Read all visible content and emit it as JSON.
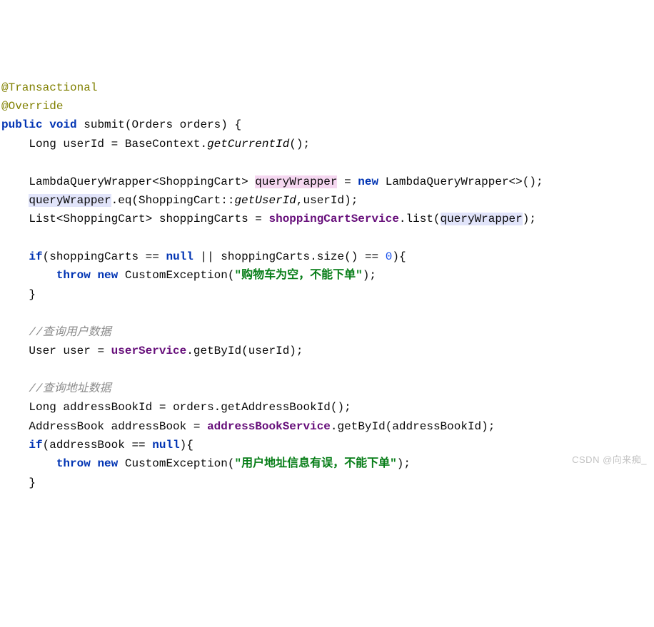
{
  "code": {
    "anno1": "@Transactional",
    "anno2": "@Override",
    "kw_public": "public",
    "kw_void": "void",
    "m_submit": "submit",
    "t_long": "Long",
    "v_userId": "userId",
    "t_basecontext": "BaseContext",
    "m_getCurrentId": "getCurrentId",
    "t_lqw": "LambdaQueryWrapper",
    "t_shoppingcart": "ShoppingCart",
    "v_querywrapper": "queryWrapper",
    "kw_new": "new",
    "m_eq": ".eq(",
    "m_getuserid": "getUserId",
    "t_list": "List",
    "v_shoppingcarts": "shoppingCarts",
    "f_shoppingcartservice": "shoppingCartService",
    "m_list": ".list(",
    "kw_if": "if",
    "kw_null": "null",
    "m_size": ".size()",
    "num_zero": "0",
    "kw_throw": "throw",
    "t_customexception": "CustomException",
    "str_carterror": "\"购物车为空，不能下单\"",
    "comment_user": "//查询用户数据",
    "t_user": "User",
    "v_user": "user",
    "f_userservice": "userService",
    "m_getbyid": ".getById(",
    "comment_addr": "//查询地址数据",
    "v_addressbookid": "addressBookId",
    "v_orders": "orders",
    "m_getaddressbookid": ".getAddressBookId()",
    "t_addressbook": "AddressBook",
    "v_addressbook": "addressBook",
    "f_addressbookservice": "addressBookService",
    "str_addrerror": "\"用户地址信息有误，不能下单\"",
    "param_orders": "(Orders orders)"
  },
  "watermark": "CSDN @向来痴_"
}
